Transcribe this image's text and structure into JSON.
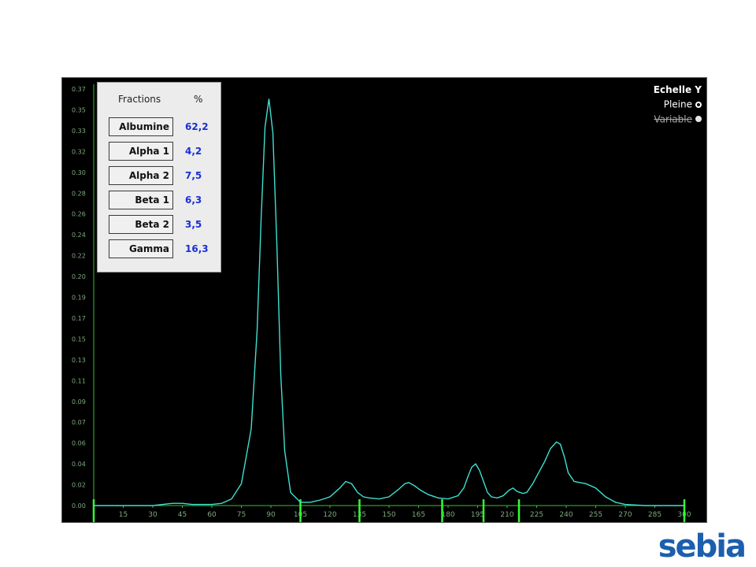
{
  "fractions_panel": {
    "header_fractions": "Fractions",
    "header_percent": "%",
    "items": [
      {
        "label": "Albumine",
        "value": "62,2"
      },
      {
        "label": "Alpha 1",
        "value": "4,2"
      },
      {
        "label": "Alpha 2",
        "value": "7,5"
      },
      {
        "label": "Beta 1",
        "value": "6,3"
      },
      {
        "label": "Beta 2",
        "value": "3,5"
      },
      {
        "label": "Gamma",
        "value": "16,3"
      }
    ]
  },
  "scale_legend": {
    "title": "Echelle Y",
    "options": [
      {
        "label": "Pleine",
        "selected": true
      },
      {
        "label": "Variable",
        "selected": false
      }
    ]
  },
  "logo_text": "sebia",
  "colors": {
    "background": "#000000",
    "curve": "#3fe0d0",
    "axis": "#2fc42f",
    "fraction_marker": "#33ff33",
    "tick_label": "#7fa77f",
    "value_text": "#1a2fd6",
    "logo": "#1c5fae"
  },
  "chart_data": {
    "type": "line",
    "title": "",
    "xlabel": "",
    "ylabel": "",
    "xlim": [
      0,
      300
    ],
    "ylim": [
      0,
      0.38
    ],
    "grid": false,
    "x_ticks": [
      "15",
      "30",
      "45",
      "60",
      "75",
      "90",
      "105",
      "120",
      "135",
      "150",
      "165",
      "180",
      "195",
      "210",
      "225",
      "240",
      "255",
      "270",
      "285",
      "300"
    ],
    "y_ticks": [
      "0.00",
      "0.02",
      "0.04",
      "0.06",
      "0.07",
      "0.09",
      "0.11",
      "0.13",
      "0.15",
      "0.17",
      "0.19",
      "0.20",
      "0.22",
      "0.24",
      "0.26",
      "0.28",
      "0.30",
      "0.32",
      "0.33",
      "0.35",
      "0.37"
    ],
    "series": [
      {
        "x": [
          0,
          20,
          30,
          35,
          40,
          45,
          50,
          60,
          65,
          70,
          75,
          80,
          83,
          85,
          87,
          89,
          91,
          93,
          95,
          97,
          100,
          105,
          110,
          115,
          120,
          125,
          128,
          131,
          134,
          137,
          140,
          145,
          150,
          155,
          158,
          160,
          163,
          166,
          170,
          175,
          180,
          185,
          188,
          190,
          192,
          194,
          196,
          198,
          200,
          202,
          205,
          208,
          211,
          213,
          215,
          218,
          220,
          223,
          226,
          229,
          232,
          235,
          237,
          239,
          241,
          244,
          247,
          250,
          255,
          260,
          265,
          270,
          280,
          290,
          300
        ],
        "y": [
          0.0,
          0.0,
          0.0,
          0.001,
          0.002,
          0.002,
          0.001,
          0.001,
          0.002,
          0.006,
          0.02,
          0.07,
          0.16,
          0.26,
          0.345,
          0.371,
          0.34,
          0.24,
          0.12,
          0.05,
          0.012,
          0.003,
          0.003,
          0.005,
          0.008,
          0.016,
          0.022,
          0.02,
          0.012,
          0.008,
          0.007,
          0.006,
          0.008,
          0.015,
          0.02,
          0.021,
          0.018,
          0.014,
          0.01,
          0.007,
          0.006,
          0.009,
          0.016,
          0.026,
          0.035,
          0.038,
          0.032,
          0.022,
          0.012,
          0.008,
          0.007,
          0.009,
          0.014,
          0.016,
          0.013,
          0.011,
          0.012,
          0.02,
          0.03,
          0.04,
          0.052,
          0.058,
          0.056,
          0.045,
          0.03,
          0.022,
          0.021,
          0.02,
          0.016,
          0.008,
          0.003,
          0.001,
          0.0,
          0.0,
          0.0
        ]
      }
    ],
    "fraction_boundaries": [
      0,
      105,
      135,
      177,
      198,
      216,
      300
    ]
  }
}
